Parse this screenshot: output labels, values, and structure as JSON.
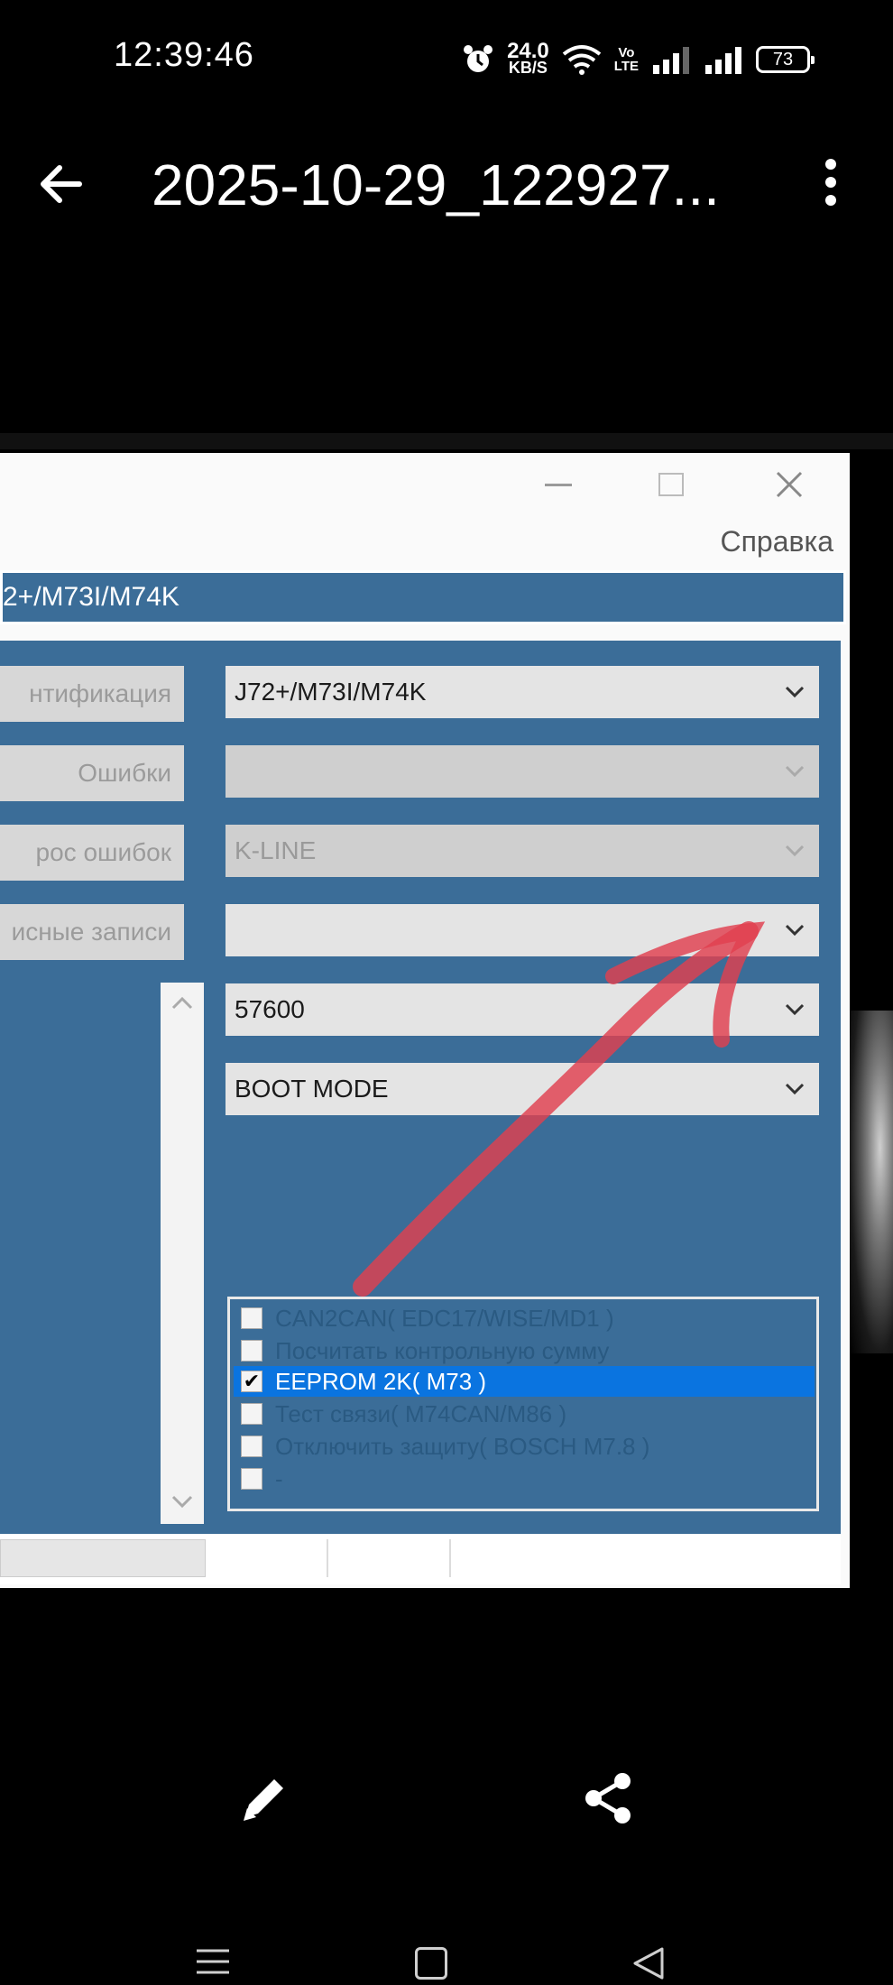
{
  "status_bar": {
    "time": "12:39:46",
    "net_speed_value": "24.0",
    "net_speed_unit": "KB/S",
    "volte_top": "Vo",
    "volte_bottom": "LTE",
    "battery": "73"
  },
  "app_bar": {
    "title": "2025-10-29_122927...",
    "back_icon": "arrow-left-icon",
    "more_icon": "more-vertical-icon"
  },
  "window": {
    "menu_help": "Справка",
    "header_title": "2+/M73I/M74K",
    "left_buttons": [
      "нтификация",
      "Ошибки",
      "рос ошибок",
      "исные записи"
    ],
    "combos": [
      {
        "value": "J72+/M73I/M74K",
        "enabled": true
      },
      {
        "value": "",
        "enabled": false
      },
      {
        "value": "K-LINE",
        "enabled": false
      },
      {
        "value": "",
        "enabled": true
      },
      {
        "value": "57600",
        "enabled": true
      },
      {
        "value": "BOOT MODE",
        "enabled": true
      }
    ],
    "checklist": [
      {
        "label": "CAN2CAN( EDC17/WISE/MD1 )",
        "checked": false,
        "selected": false
      },
      {
        "label": "Посчитать контрольную сумму",
        "checked": false,
        "selected": false
      },
      {
        "label": "EEPROM 2K( M73 )",
        "checked": true,
        "selected": true
      },
      {
        "label": "Тест связи( M74CAN/M86 )",
        "checked": false,
        "selected": false
      },
      {
        "label": "Отключить защиту( BOSCH M7.8 )",
        "checked": false,
        "selected": false
      },
      {
        "label": "-",
        "checked": false,
        "selected": false
      }
    ],
    "check_mark": "✔"
  },
  "colors": {
    "panel_blue": "#3b6d98",
    "selection_blue": "#0a74e0",
    "annotation_red": "#e0404f"
  },
  "actions": {
    "edit_icon": "pencil-icon",
    "share_icon": "share-icon"
  }
}
